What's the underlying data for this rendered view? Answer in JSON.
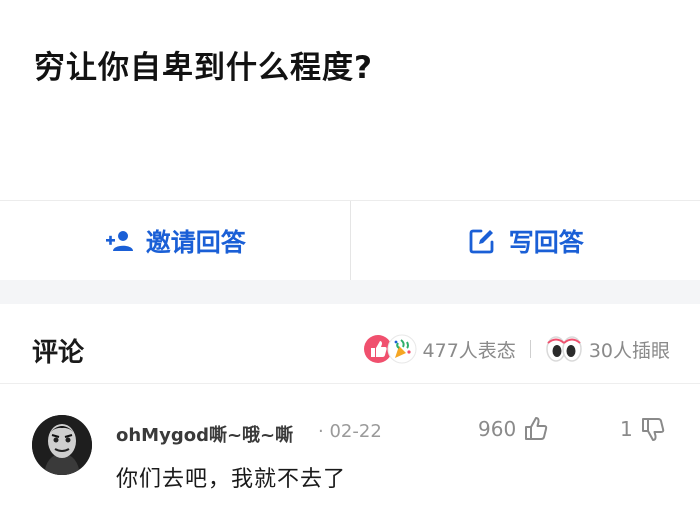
{
  "question": {
    "title": "穷让你自卑到什么程度?"
  },
  "actions": {
    "invite_label": "邀请回答",
    "write_label": "写回答"
  },
  "comments_header": {
    "title": "评论",
    "reactions_text": "477人表态",
    "eye_text": "30人插眼"
  },
  "comment": {
    "author": "ohMygod嘶~哦~嘶",
    "separator": "·",
    "date": "02-22",
    "likes": "960",
    "dislikes": "1",
    "text": "你们去吧，我就不去了"
  },
  "colors": {
    "accent": "#1a5fd6",
    "muted": "#8a8a8a",
    "band": "#f4f5f7"
  },
  "icons": [
    "add-user-icon",
    "edit-icon",
    "thumbs-up-reaction-icon",
    "party-reaction-icon",
    "eyes-icon",
    "like-icon",
    "dislike-icon"
  ]
}
